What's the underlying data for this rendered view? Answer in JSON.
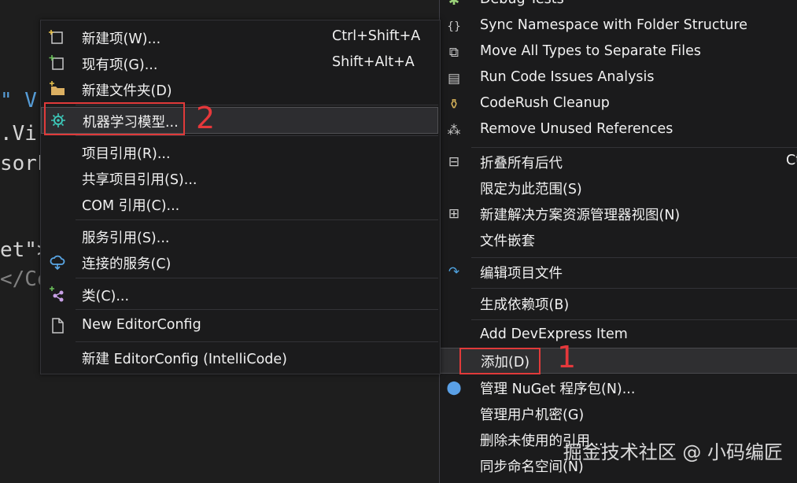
{
  "editor": {
    "lines": [
      "\" V",
      ".Vi",
      "sorF",
      "et\">",
      "</Co"
    ]
  },
  "right_menu": {
    "items": [
      {
        "label": "Debug Tests",
        "icon": "debug-tests-icon"
      },
      {
        "label": "Sync Namespace with Folder Structure",
        "icon": "sync-namespace-icon"
      },
      {
        "label": "Move All Types to Separate Files",
        "icon": "move-types-icon"
      },
      {
        "label": "Run Code Issues Analysis",
        "icon": "code-analysis-icon"
      },
      {
        "label": "CodeRush Cleanup",
        "icon": "broom-icon"
      },
      {
        "label": "Remove Unused References",
        "icon": "remove-references-icon"
      },
      {
        "label": "折叠所有后代",
        "icon": "collapse-icon",
        "shortcut": "Ct"
      },
      {
        "label": "限定为此范围(S)",
        "icon": ""
      },
      {
        "label": "新建解决方案资源管理器视图(N)",
        "icon": "new-view-icon"
      },
      {
        "label": "文件嵌套",
        "icon": ""
      },
      {
        "label": "编辑项目文件",
        "icon": "edit-project-icon"
      },
      {
        "label": "生成依赖项(B)",
        "icon": ""
      },
      {
        "label": "Add DevExpress Item",
        "icon": ""
      },
      {
        "label": "添加(D)",
        "icon": ""
      },
      {
        "label": "管理 NuGet 程序包(N)...",
        "icon": "nuget-icon"
      },
      {
        "label": "管理用户机密(G)",
        "icon": ""
      },
      {
        "label": "删除未使用的引用...",
        "icon": ""
      },
      {
        "label": "同步命名空间(N)",
        "icon": ""
      }
    ]
  },
  "left_menu": {
    "items": [
      {
        "label": "新建项(W)...",
        "shortcut": "Ctrl+Shift+A",
        "icon": "new-item-icon"
      },
      {
        "label": "现有项(G)...",
        "shortcut": "Shift+Alt+A",
        "icon": "existing-item-icon"
      },
      {
        "label": "新建文件夹(D)",
        "shortcut": "",
        "icon": "new-folder-icon"
      },
      {
        "label": "机器学习模型...",
        "shortcut": "",
        "icon": "ml-model-icon"
      },
      {
        "label": "项目引用(R)...",
        "shortcut": "",
        "icon": ""
      },
      {
        "label": "共享项目引用(S)...",
        "shortcut": "",
        "icon": ""
      },
      {
        "label": "COM 引用(C)...",
        "shortcut": "",
        "icon": ""
      },
      {
        "label": "服务引用(S)...",
        "shortcut": "",
        "icon": ""
      },
      {
        "label": "连接的服务(C)",
        "shortcut": "",
        "icon": "connected-services-icon"
      },
      {
        "label": "类(C)...",
        "shortcut": "",
        "icon": "class-icon"
      },
      {
        "label": "New EditorConfig",
        "shortcut": "",
        "icon": "file-icon"
      },
      {
        "label": "新建 EditorConfig (IntelliCode)",
        "shortcut": "",
        "icon": ""
      }
    ]
  },
  "annotations": {
    "step1": "1",
    "step2": "2"
  },
  "watermark": "掘金技术社区 @ 小码编匠",
  "colors": {
    "background": "#1e1e1e",
    "menu_bg": "#1b1b1c",
    "annotation_red": "#e03a3a",
    "highlight": "#2d2d30"
  }
}
